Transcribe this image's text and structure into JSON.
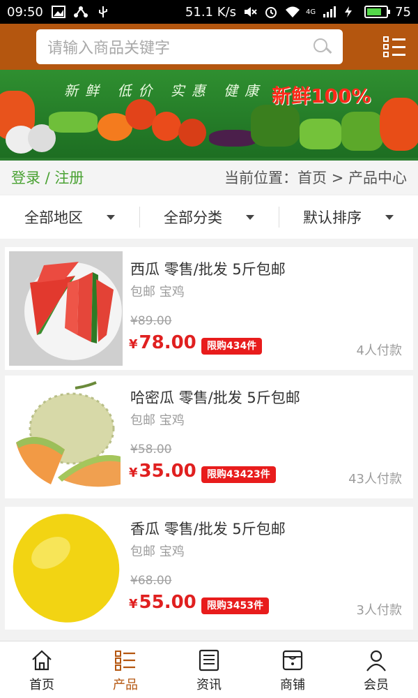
{
  "status_bar": {
    "time": "09:50",
    "speed": "51.1 K/s",
    "network": "4G",
    "battery": "75",
    "battery_level": 0.75
  },
  "search": {
    "placeholder": "请输入商品关键字"
  },
  "banner": {
    "slogan": "新鲜 低价 实惠 健康",
    "fresh_text": "新鲜100%"
  },
  "crumbbar": {
    "login_link": "登录 / 注册",
    "location": "当前位置：首页 > 产品中心"
  },
  "filters": [
    {
      "label": "全部地区"
    },
    {
      "label": "全部分类"
    },
    {
      "label": "默认排序"
    }
  ],
  "products": [
    {
      "title": "西瓜 零售/批发 5斤包邮",
      "location": "包邮 宝鸡",
      "old_price": "¥89.00",
      "price_symbol": "¥",
      "price": "78.00",
      "badge": "限购434件",
      "sold": "4人付款"
    },
    {
      "title": "哈密瓜 零售/批发 5斤包邮",
      "location": "包邮 宝鸡",
      "old_price": "¥58.00",
      "price_symbol": "¥",
      "price": "35.00",
      "badge": "限购43423件",
      "sold": "43人付款"
    },
    {
      "title": "香瓜 零售/批发 5斤包邮",
      "location": "包邮 宝鸡",
      "old_price": "¥68.00",
      "price_symbol": "¥",
      "price": "55.00",
      "badge": "限购3453件",
      "sold": "3人付款"
    }
  ],
  "nav": [
    {
      "label": "首页",
      "icon": "home-icon"
    },
    {
      "label": "产品",
      "icon": "list-icon",
      "active": true
    },
    {
      "label": "资讯",
      "icon": "news-icon"
    },
    {
      "label": "商铺",
      "icon": "shop-icon"
    },
    {
      "label": "会员",
      "icon": "user-icon"
    }
  ],
  "colors": {
    "header": "#b4560f",
    "price": "#e02020",
    "login": "#4aa233"
  }
}
